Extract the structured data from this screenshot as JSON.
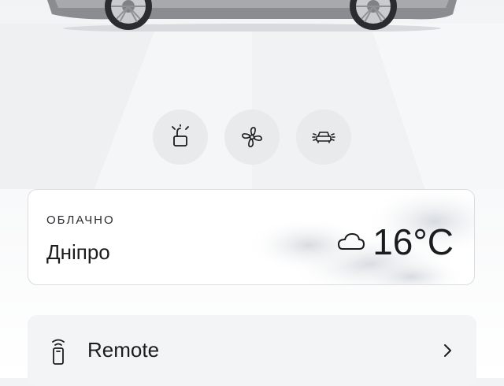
{
  "quick_actions": [
    {
      "icon": "unlock-icon"
    },
    {
      "icon": "fan-icon"
    },
    {
      "icon": "car-lights-icon"
    }
  ],
  "weather": {
    "condition": "ОБЛАЧНО",
    "city": "Дніпро",
    "temperature": "16°C",
    "icon": "cloud-icon"
  },
  "remote": {
    "label": "Remote",
    "icon": "remote-key-icon",
    "chevron": "chevron-right-icon"
  }
}
